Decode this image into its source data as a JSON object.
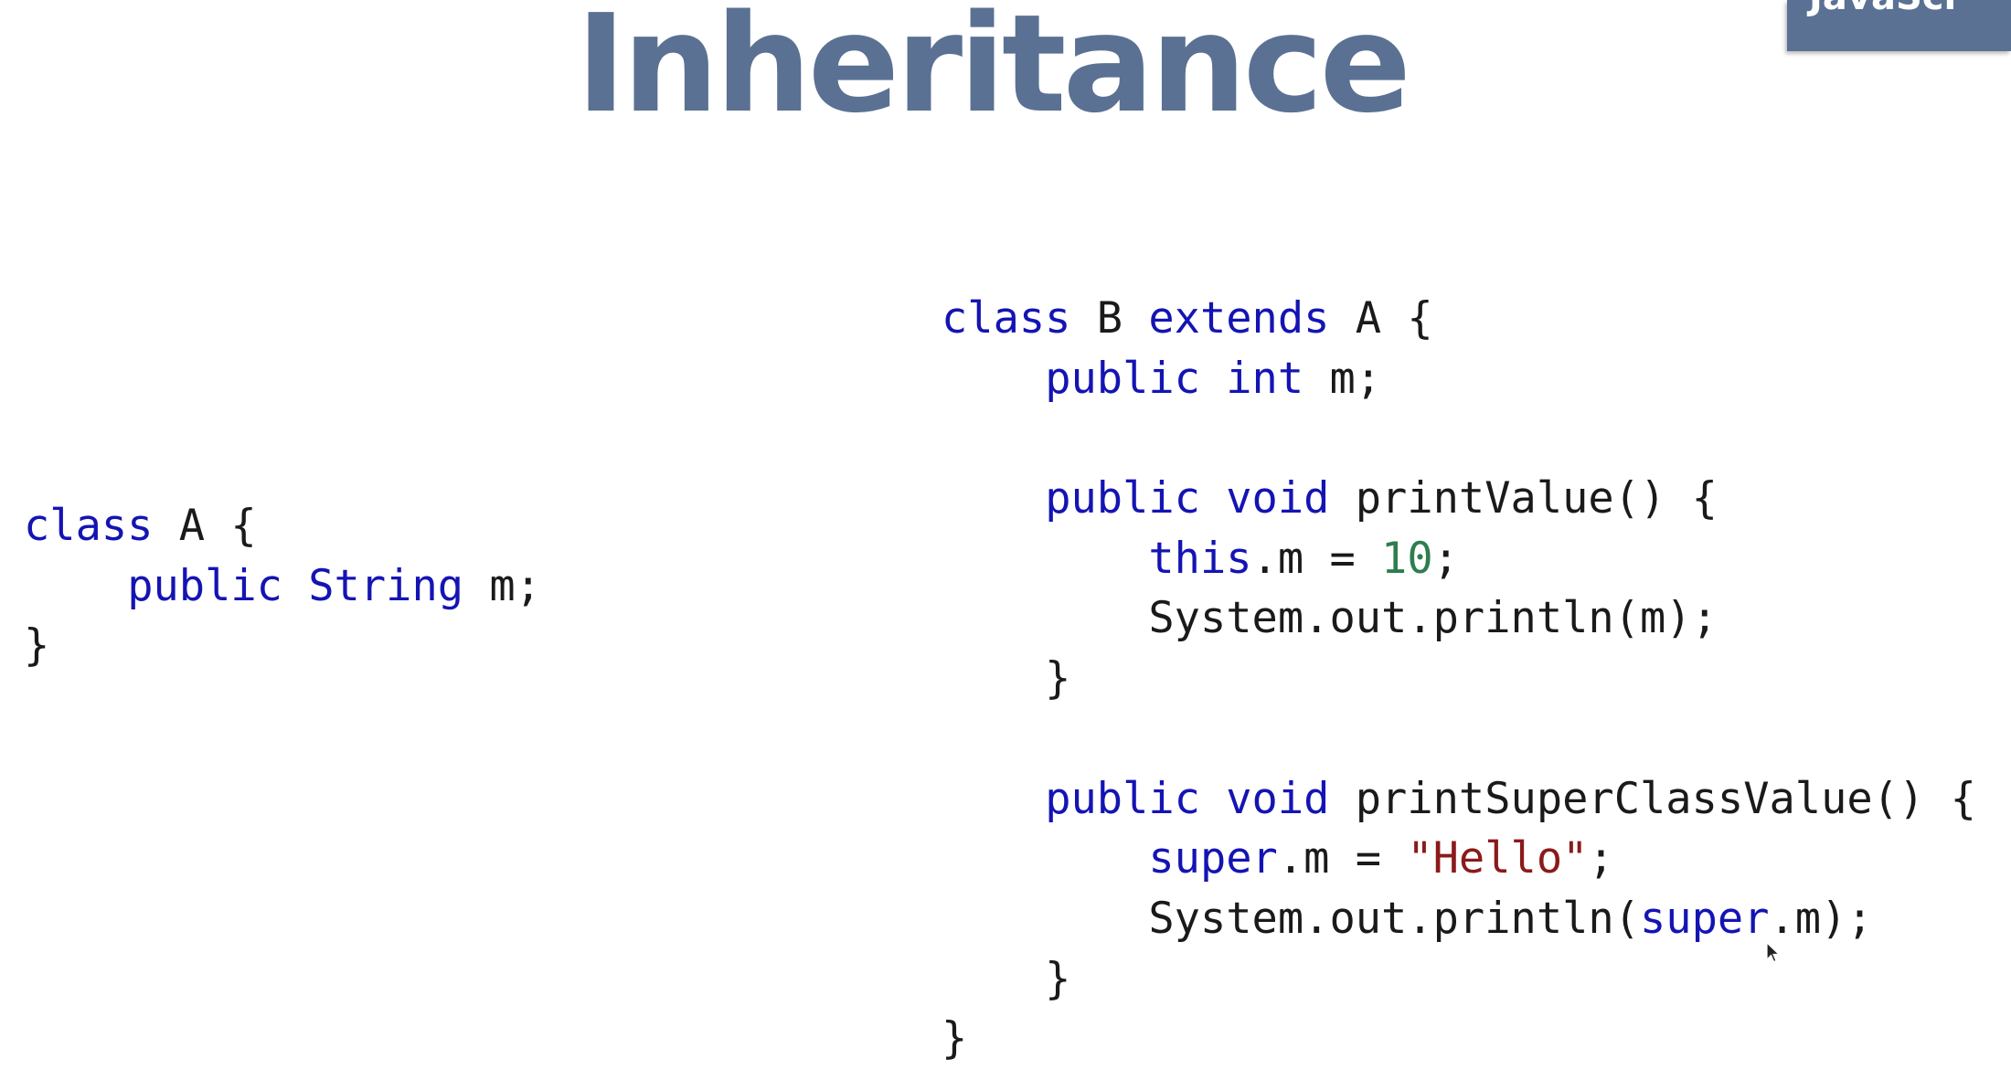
{
  "slide": {
    "title": "Inheritance",
    "corner_badge": "JavaScr",
    "colors": {
      "title": "#5a7193",
      "keyword": "#1414b4",
      "number": "#2e7d4f",
      "string": "#8b1a1a",
      "text": "#1a1a1a"
    }
  },
  "code_a": {
    "lines": [
      [
        {
          "t": "class",
          "k": "kw"
        },
        {
          "t": " A {"
        }
      ],
      [
        {
          "t": "    "
        },
        {
          "t": "public",
          "k": "kw"
        },
        {
          "t": " "
        },
        {
          "t": "String",
          "k": "kw"
        },
        {
          "t": " m;"
        }
      ],
      [
        {
          "t": "}"
        }
      ]
    ]
  },
  "code_b": {
    "lines": [
      [
        {
          "t": "class",
          "k": "kw"
        },
        {
          "t": " B "
        },
        {
          "t": "extends",
          "k": "kw"
        },
        {
          "t": " A {"
        }
      ],
      [
        {
          "t": "    "
        },
        {
          "t": "public",
          "k": "kw"
        },
        {
          "t": " "
        },
        {
          "t": "int",
          "k": "kw"
        },
        {
          "t": " m;"
        }
      ],
      [
        {
          "t": ""
        }
      ],
      [
        {
          "t": "    "
        },
        {
          "t": "public",
          "k": "kw"
        },
        {
          "t": " "
        },
        {
          "t": "void",
          "k": "kw"
        },
        {
          "t": " printValue() {"
        }
      ],
      [
        {
          "t": "        "
        },
        {
          "t": "this",
          "k": "kw"
        },
        {
          "t": ".m = "
        },
        {
          "t": "10",
          "k": "num"
        },
        {
          "t": ";"
        }
      ],
      [
        {
          "t": "        System.out.println(m);"
        }
      ],
      [
        {
          "t": "    }"
        }
      ],
      [
        {
          "t": ""
        }
      ],
      [
        {
          "t": "    "
        },
        {
          "t": "public",
          "k": "kw"
        },
        {
          "t": " "
        },
        {
          "t": "void",
          "k": "kw"
        },
        {
          "t": " printSuperClassValue() {"
        }
      ],
      [
        {
          "t": "        "
        },
        {
          "t": "super",
          "k": "kw"
        },
        {
          "t": ".m = "
        },
        {
          "t": "\"Hello\"",
          "k": "str"
        },
        {
          "t": ";"
        }
      ],
      [
        {
          "t": "        System.out.println("
        },
        {
          "t": "super",
          "k": "kw"
        },
        {
          "t": ".m);"
        }
      ],
      [
        {
          "t": "    }"
        }
      ],
      [
        {
          "t": "}"
        }
      ]
    ]
  },
  "cursor": {
    "icon": "mouse-pointer-icon"
  }
}
